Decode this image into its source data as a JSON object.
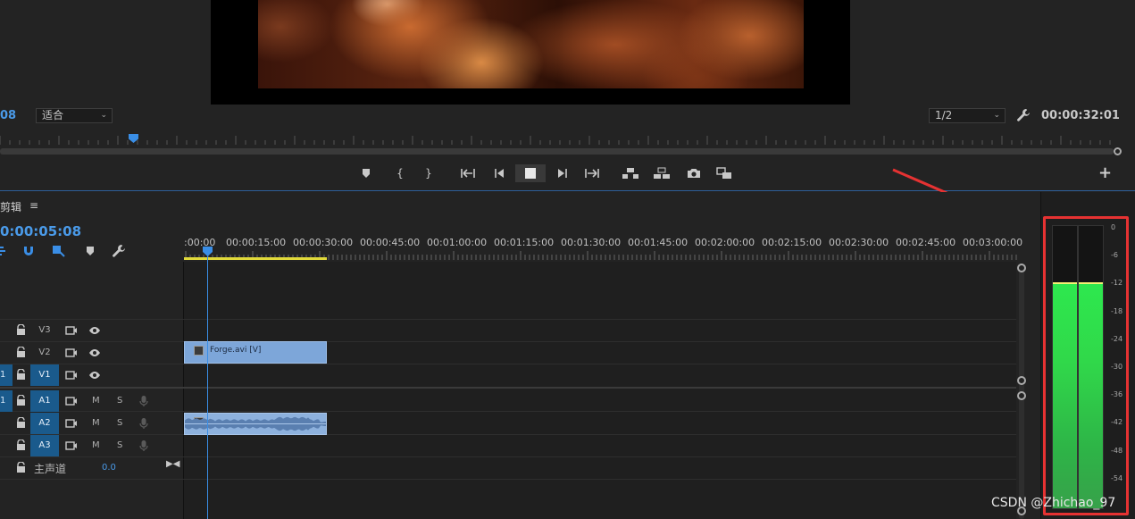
{
  "monitor": {
    "timecode_left": "08",
    "fit_select": "适合",
    "resolution_select": "1/2",
    "timecode_right": "00:00:32:01"
  },
  "timeline": {
    "title": "剪辑",
    "timecode": "0:00:05:08",
    "ruler_labels": [
      ":00:00",
      "00:00:15:00",
      "00:00:30:00",
      "00:00:45:00",
      "00:01:00:00",
      "00:01:15:00",
      "00:01:30:00",
      "00:01:45:00",
      "00:02:00:00",
      "00:02:15:00",
      "00:02:30:00",
      "00:02:45:00",
      "00:03:00:00"
    ],
    "tracks": {
      "v3": "V3",
      "v2": "V2",
      "v1": "V1",
      "a1": "A1",
      "a2": "A2",
      "a3": "A3",
      "src_v1": "1",
      "src_a1": "1",
      "m": "M",
      "s": "S"
    },
    "clips": {
      "v2": "Forge.avi [V]"
    },
    "master": {
      "label": "主声道",
      "value": "0.0"
    }
  },
  "meter": {
    "db_labels": [
      "0",
      "-6",
      "-12",
      "-18",
      "-24",
      "-30",
      "-36",
      "-42",
      "-48",
      "-54"
    ],
    "level_db": -12,
    "colors": {
      "fill": "#2ee84e",
      "peak": "#f4f074",
      "highlight": "#e63232",
      "annotation_arrow": "#e63232"
    }
  },
  "watermark": "CSDN @Zhichao_97"
}
